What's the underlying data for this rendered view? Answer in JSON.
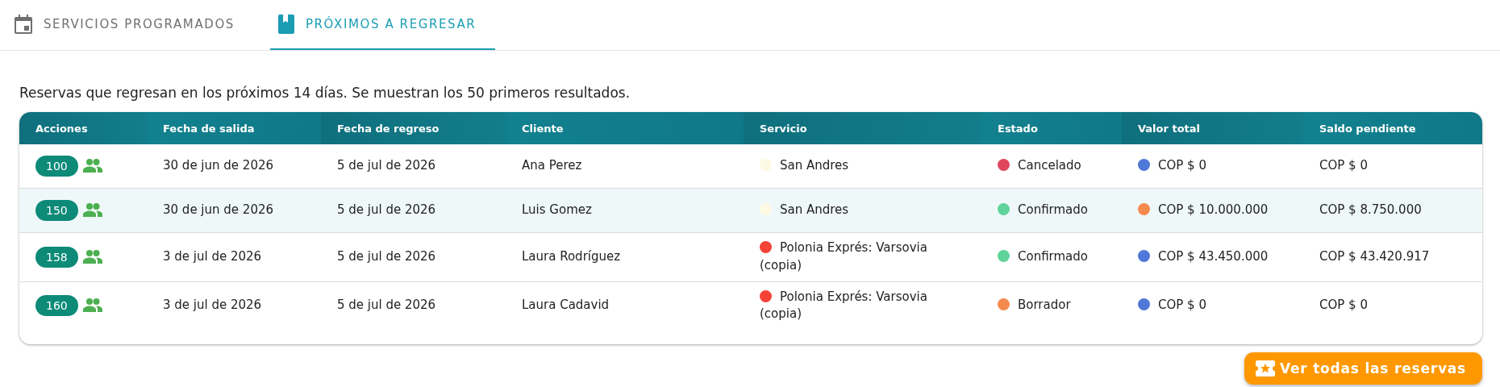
{
  "tabs": [
    {
      "label": "SERVICIOS PROGRAMADOS",
      "selected": false
    },
    {
      "label": "PRÓXIMOS A REGRESAR",
      "selected": true
    }
  ],
  "description": "Reservas que regresan en los próximos 14 días. Se muestran los 50 primeros resultados.",
  "table": {
    "columns": [
      "Acciones",
      "Fecha de salida",
      "Fecha de regreso",
      "Cliente",
      "Servicio",
      "Estado",
      "Valor total",
      "Saldo pendiente"
    ],
    "rows": [
      {
        "id": "100",
        "highlighted": false,
        "departure": "30 de jun de 2026",
        "return": "5 de jul de 2026",
        "client": "Ana Perez",
        "service": {
          "label": "San Andres",
          "color": "#fdf9e3"
        },
        "status": {
          "label": "Cancelado",
          "color": "#e0465e"
        },
        "total": {
          "label": "COP $ 0",
          "color": "#4f78d8"
        },
        "balance": "COP $ 0"
      },
      {
        "id": "150",
        "highlighted": true,
        "departure": "30 de jun de 2026",
        "return": "5 de jul de 2026",
        "client": "Luis Gomez",
        "service": {
          "label": "San Andres",
          "color": "#fdf9e3"
        },
        "status": {
          "label": "Confirmado",
          "color": "#5fd39a"
        },
        "total": {
          "label": "COP $ 10.000.000",
          "color": "#f58a4e"
        },
        "balance": "COP $ 8.750.000"
      },
      {
        "id": "158",
        "highlighted": false,
        "departure": "3 de jul de 2026",
        "return": "5 de jul de 2026",
        "client": "Laura Rodríguez",
        "service": {
          "label": "Polonia Exprés: Varsovia (copia)",
          "color": "#f44336"
        },
        "status": {
          "label": "Confirmado",
          "color": "#5fd39a"
        },
        "total": {
          "label": "COP $ 43.450.000",
          "color": "#4f78d8"
        },
        "balance": "COP $ 43.420.917"
      },
      {
        "id": "160",
        "highlighted": false,
        "departure": "3 de jul de 2026",
        "return": "5 de jul de 2026",
        "client": "Laura Cadavid",
        "service": {
          "label": "Polonia Exprés: Varsovia (copia)",
          "color": "#f44336"
        },
        "status": {
          "label": "Borrador",
          "color": "#f58a4e"
        },
        "total": {
          "label": "COP $ 0",
          "color": "#4f78d8"
        },
        "balance": "COP $ 0"
      }
    ]
  },
  "action_button": {
    "label": "Ver todas las reservas"
  }
}
